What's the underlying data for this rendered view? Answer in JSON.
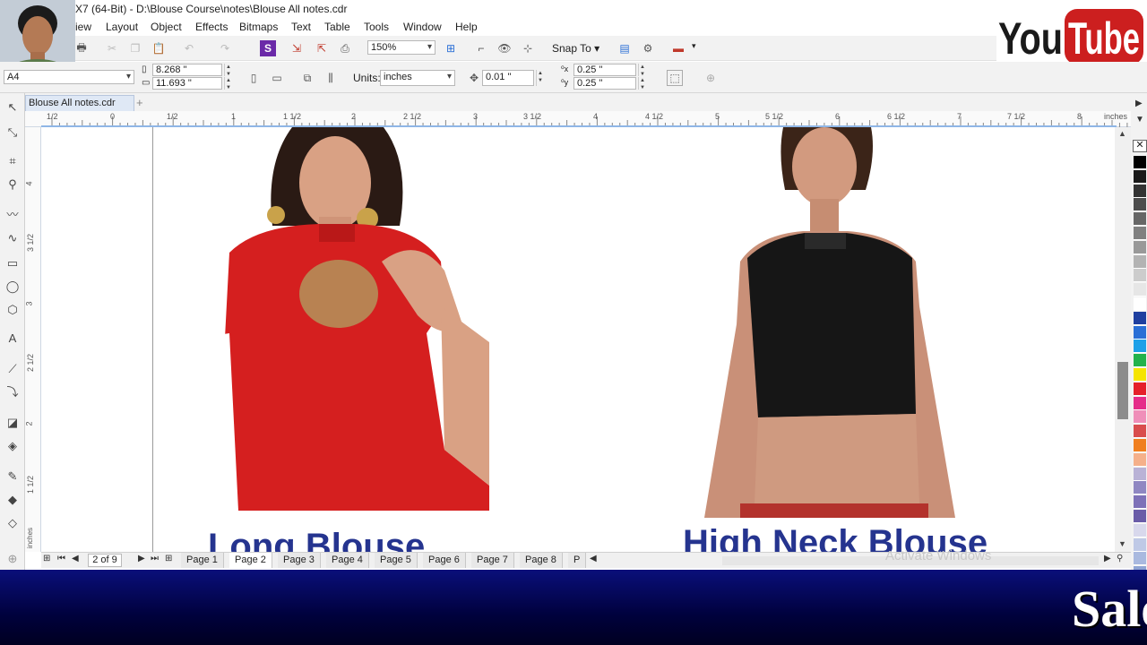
{
  "window": {
    "title": "X7 (64-Bit) - D:\\Blouse Course\\notes\\Blouse All notes.cdr"
  },
  "menu": {
    "items": [
      "iew",
      "Layout",
      "Object",
      "Effects",
      "Bitmaps",
      "Text",
      "Table",
      "Tools",
      "Window",
      "Help"
    ]
  },
  "toolbar": {
    "zoom_value": "150%",
    "snap_label": "Snap To"
  },
  "property_bar": {
    "page_size": "A4",
    "width": "8.268 \"",
    "height": "11.693 \"",
    "units_label": "Units:",
    "units_value": "inches",
    "nudge": "0.01 \"",
    "dup_x": "0.25 \"",
    "dup_y": "0.25 \""
  },
  "document": {
    "tab_label": "Blouse All notes.cdr"
  },
  "ruler": {
    "unit_label": "inches",
    "h_ticks": [
      "1/2",
      "0",
      "1/2",
      "1",
      "1 1/2",
      "2",
      "2 1/2",
      "3",
      "3 1/2",
      "4",
      "4 1/2",
      "5",
      "5 1/2",
      "6",
      "6 1/2",
      "7",
      "7 1/2",
      "8"
    ],
    "v_ticks": [
      "4",
      "3 1/2",
      "3",
      "2 1/2",
      "2",
      "1 1/2"
    ],
    "v_unit_label": "inches"
  },
  "canvas": {
    "caption_left": "Long Blouse",
    "caption_right": "High Neck Blouse"
  },
  "page_nav": {
    "counter": "2 of 9",
    "pages": [
      "Page 1",
      "Page 2",
      "Page 3",
      "Page 4",
      "Page 5",
      "Page 6",
      "Page 7",
      "Page 8",
      "P"
    ],
    "active_page": "Page 2"
  },
  "watermark": {
    "text": "Activate Windows"
  },
  "branding": {
    "youtube_you": "You",
    "youtube_tube": "Tube",
    "banner_text": "Sale"
  },
  "palette": {
    "colors": [
      "#000000",
      "#1a1a1a",
      "#333333",
      "#4d4d4d",
      "#666666",
      "#808080",
      "#999999",
      "#b3b3b3",
      "#cccccc",
      "#e6e6e6",
      "#ffffff",
      "#1f3fa0",
      "#2a6fd6",
      "#1ea0e8",
      "#22b24c",
      "#f5e400",
      "#e5202a",
      "#e52d8a",
      "#ef8fb9",
      "#d94d4d",
      "#f07f1f",
      "#f5b08a",
      "#b9b2d6",
      "#8f87c2",
      "#7e71b8",
      "#6a5ca8",
      "#d8d8ec",
      "#bfc9e6",
      "#a9b9df",
      "#8fa4d4",
      "#7b91c9",
      "#6e7fb7"
    ]
  }
}
